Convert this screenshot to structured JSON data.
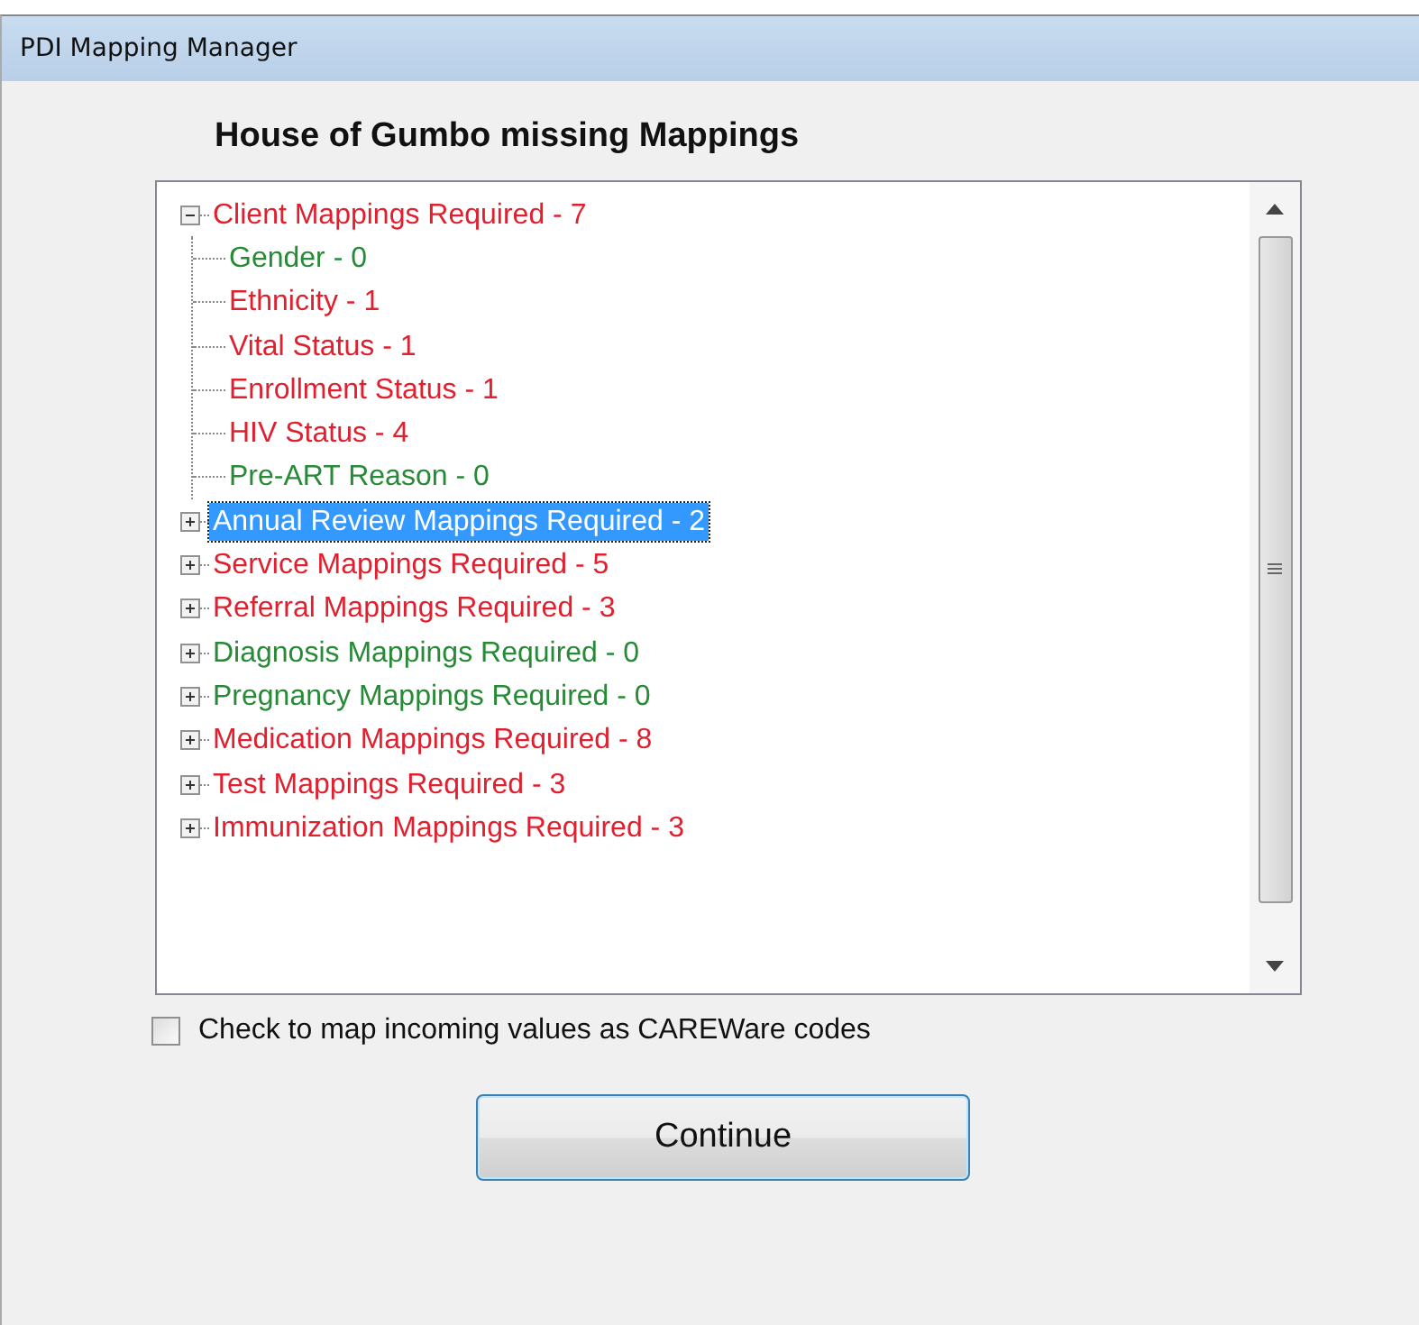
{
  "window": {
    "title": "PDI Mapping Manager"
  },
  "heading": "House of Gumbo missing Mappings",
  "tree": [
    {
      "label": "Client Mappings Required - 7",
      "color": "#e0202e",
      "expanded": true,
      "selected": false,
      "children": [
        {
          "label": "Gender - 0",
          "color": "#268a36",
          "selected": false
        },
        {
          "label": "Ethnicity - 1",
          "color": "#e0202e",
          "selected": false
        },
        {
          "label": "Vital Status - 1",
          "color": "#e0202e",
          "selected": false
        },
        {
          "label": "Enrollment Status - 1",
          "color": "#e0202e",
          "selected": false
        },
        {
          "label": "HIV Status - 4",
          "color": "#e0202e",
          "selected": false
        },
        {
          "label": "Pre-ART Reason - 0",
          "color": "#268a36",
          "selected": false
        }
      ]
    },
    {
      "label": "Annual Review Mappings Required - 2",
      "expanded": false,
      "selected": true
    },
    {
      "label": "Service Mappings Required - 5",
      "color": "#e0202e",
      "expanded": false,
      "selected": false
    },
    {
      "label": "Referral Mappings Required - 3",
      "color": "#e0202e",
      "expanded": false,
      "selected": false
    },
    {
      "label": "Diagnosis Mappings Required - 0",
      "color": "#268a36",
      "expanded": false,
      "selected": false
    },
    {
      "label": "Pregnancy Mappings Required - 0",
      "color": "#268a36",
      "expanded": false,
      "selected": false
    },
    {
      "label": "Medication Mappings Required - 8",
      "color": "#e0202e",
      "expanded": false,
      "selected": false
    },
    {
      "label": "Test Mappings Required - 3",
      "color": "#e0202e",
      "expanded": false,
      "selected": false
    },
    {
      "label": "Immunization Mappings Required - 3",
      "color": "#e0202e",
      "expanded": false,
      "selected": false
    }
  ],
  "checkbox": {
    "label": "Check to map incoming values as CAREWare codes",
    "checked": false
  },
  "buttons": [
    "Continue"
  ]
}
